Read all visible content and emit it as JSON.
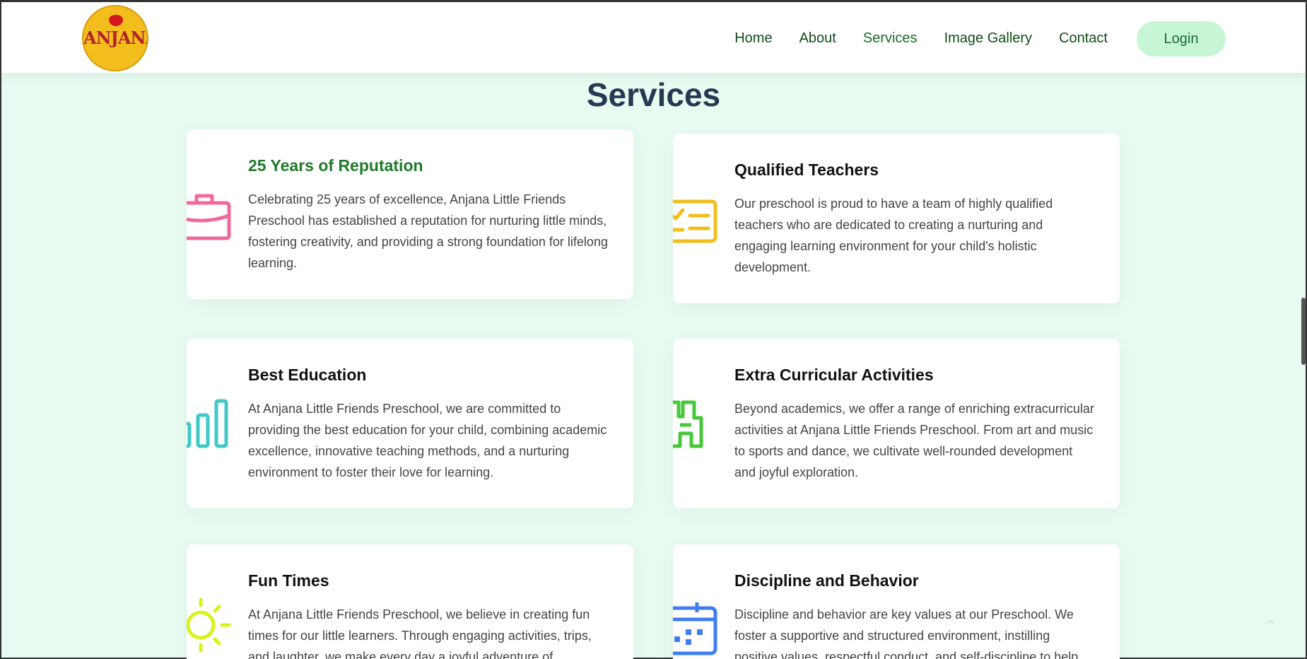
{
  "logo": {
    "text": "ANJANA"
  },
  "nav": {
    "items": [
      "Home",
      "About",
      "Services",
      "Image Gallery",
      "Contact"
    ],
    "active": "Services",
    "login_label": "Login"
  },
  "section": {
    "title": "Services"
  },
  "cards": [
    {
      "title": "25 Years of Reputation",
      "description": "Celebrating 25 years of excellence, Anjana Little Friends Preschool has established a reputation for nurturing little minds, fostering creativity, and providing a strong foundation for lifelong learning.",
      "icon": "briefcase-icon",
      "icon_color": "#f0689c"
    },
    {
      "title": "Qualified Teachers",
      "description": "Our preschool is proud to have a team of highly qualified teachers who are dedicated to creating a nurturing and engaging learning environment for your child's holistic development.",
      "icon": "id-card-icon",
      "icon_color": "#f2be1d"
    },
    {
      "title": "Best Education",
      "description": "At Anjana Little Friends Preschool, we are committed to providing the best education for your child, combining academic excellence, innovative teaching methods, and a nurturing environment to foster their love for learning.",
      "icon": "bar-chart-icon",
      "icon_color": "#3ec8c8"
    },
    {
      "title": "Extra Curricular Activities",
      "description": "Beyond academics, we offer a range of enriching extracurricular activities at Anjana Little Friends Preschool. From art and music to sports and dance, we cultivate well-rounded development and joyful exploration.",
      "icon": "binoculars-icon",
      "icon_color": "#47c83a"
    },
    {
      "title": "Fun Times",
      "description": "At Anjana Little Friends Preschool, we believe in creating fun times for our little learners. Through engaging activities, trips, and laughter, we make every day a joyful adventure of",
      "icon": "sun-icon",
      "icon_color": "#d9f21b"
    },
    {
      "title": "Discipline and Behavior",
      "description": "Discipline and behavior are key values at our Preschool. We foster a supportive and structured environment, instilling positive values, respectful conduct, and self-discipline to help",
      "icon": "calendar-icon",
      "icon_color": "#3f7df0"
    }
  ]
}
